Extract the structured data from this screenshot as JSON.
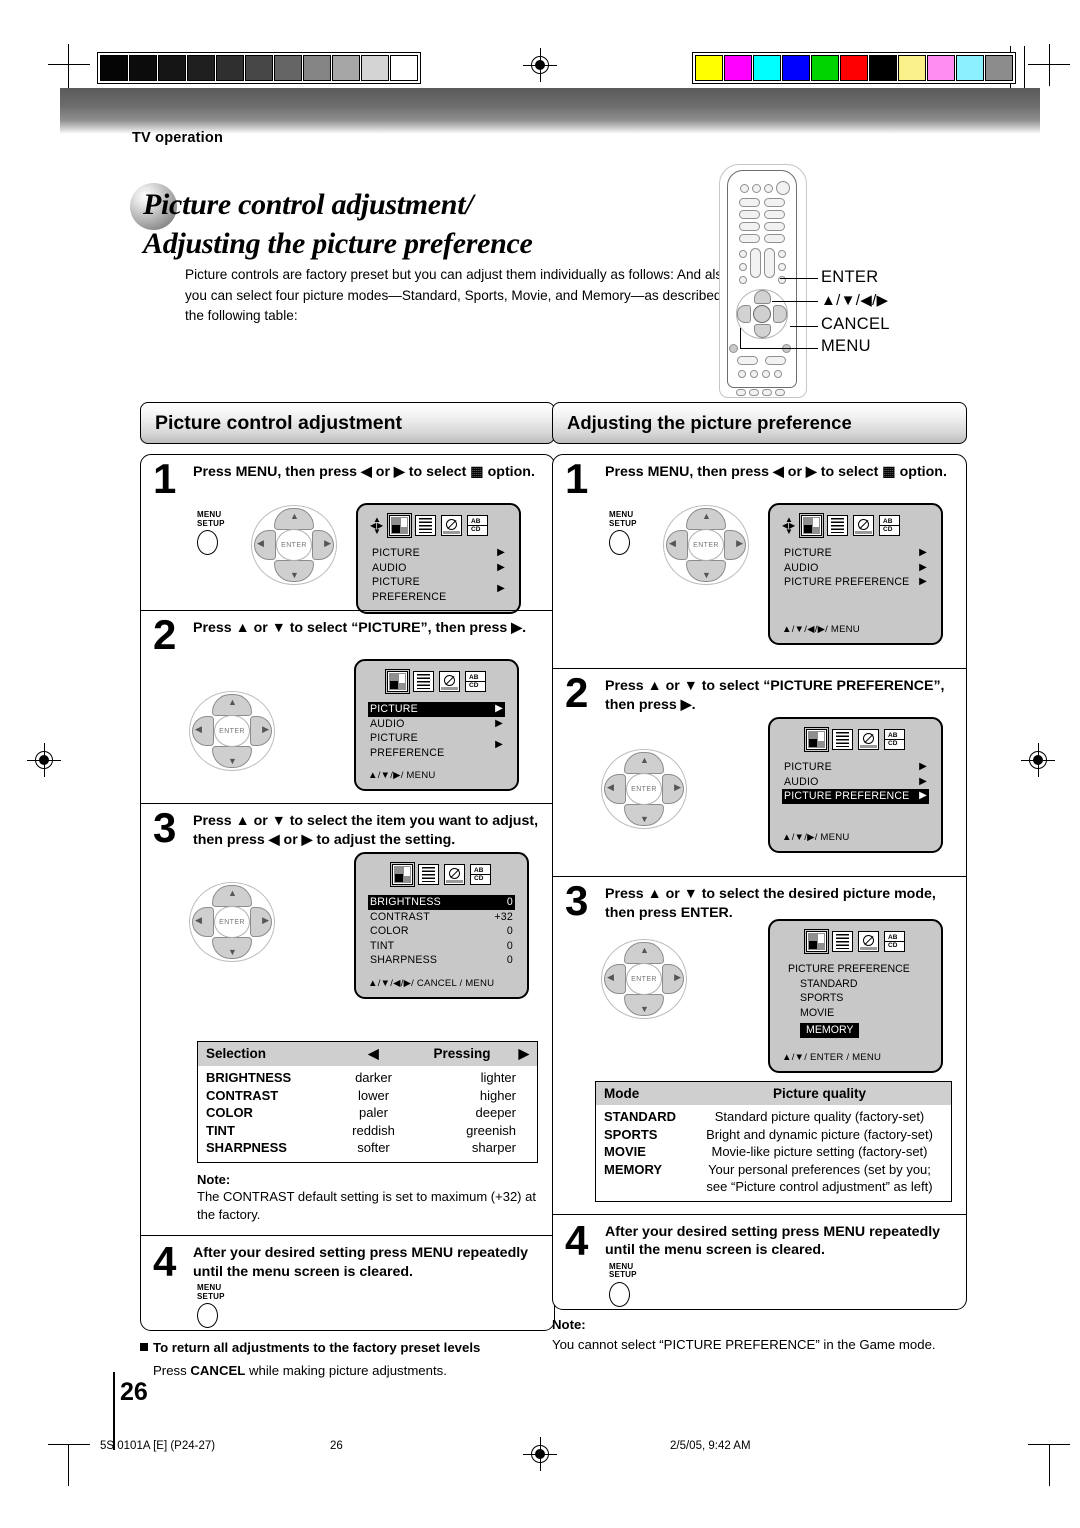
{
  "header": {
    "section_label": "TV operation"
  },
  "title": {
    "line1": "Picture control adjustment/",
    "line2": "Adjusting the picture preference"
  },
  "intro": "Picture controls are factory preset but you can adjust them individually as follows: And also you can select four picture modes—Standard, Sports, Movie, and Memory—as described in the following table:",
  "remote_callouts": [
    {
      "label": "ENTER"
    },
    {
      "label": "▲/▼/◀/▶"
    },
    {
      "label": "CANCEL"
    },
    {
      "label": "MENU"
    }
  ],
  "osd_common": {
    "menu_rows": [
      "PICTURE",
      "AUDIO",
      "PICTURE  PREFERENCE"
    ],
    "arrow": "▶",
    "icon_names": [
      "picture-icon",
      "audio-icon",
      "function-icon",
      "captions-icon"
    ],
    "captions_icon_top": "AB",
    "captions_icon_bottom": "CD"
  },
  "left_column": {
    "title": "Picture control adjustment",
    "steps": [
      {
        "num": "1",
        "text": "Press MENU, then press ◀ or ▶ to select ▦ option.",
        "menu_button": {
          "line1": "MENU",
          "line2": "SETUP"
        },
        "dpad_center": "ENTER",
        "osd": {
          "hint": ""
        }
      },
      {
        "num": "2",
        "text": "Press ▲ or ▼ to select “PICTURE”, then press ▶.",
        "dpad_center": "ENTER",
        "osd": {
          "highlight": "PICTURE",
          "hint": "▲/▼/▶/ MENU"
        }
      },
      {
        "num": "3",
        "text": "Press ▲ or ▼ to select the item you want to adjust, then press ◀ or ▶ to adjust the setting.",
        "dpad_center": "ENTER",
        "osd": {
          "items": [
            {
              "name": "BRIGHTNESS",
              "value": "0",
              "highlight": true
            },
            {
              "name": "CONTRAST",
              "value": "+32",
              "highlight": false
            },
            {
              "name": "COLOR",
              "value": "0",
              "highlight": false
            },
            {
              "name": "TINT",
              "value": "0",
              "highlight": false
            },
            {
              "name": "SHARPNESS",
              "value": "0",
              "highlight": false
            }
          ],
          "hint": "▲/▼/◀/▶/ CANCEL / MENU"
        }
      },
      {
        "num": "4",
        "text": "After your desired setting press MENU repeatedly until the menu screen is cleared.",
        "menu_button": {
          "line1": "MENU",
          "line2": "SETUP"
        }
      }
    ],
    "table": {
      "headers": {
        "selection": "Selection",
        "left_arrow": "◀",
        "pressing": "Pressing",
        "right_arrow": "▶"
      },
      "rows": [
        {
          "selection": "BRIGHTNESS",
          "left": "darker",
          "right": "lighter"
        },
        {
          "selection": "CONTRAST",
          "left": "lower",
          "right": "higher"
        },
        {
          "selection": "COLOR",
          "left": "paler",
          "right": "deeper"
        },
        {
          "selection": "TINT",
          "left": "reddish",
          "right": "greenish"
        },
        {
          "selection": "SHARPNESS",
          "left": "softer",
          "right": "sharper"
        }
      ]
    },
    "note": {
      "label": "Note:",
      "text": "The CONTRAST default setting is set to maximum (+32) at the factory."
    },
    "footnote": {
      "heading": "To return all adjustments to the factory preset levels",
      "body_pre": "Press ",
      "body_bold": "CANCEL",
      "body_post": " while making picture adjustments."
    }
  },
  "right_column": {
    "title": "Adjusting the picture preference",
    "steps": [
      {
        "num": "1",
        "text": "Press MENU, then press ◀ or ▶ to select ▦ option.",
        "menu_button": {
          "line1": "MENU",
          "line2": "SETUP"
        },
        "dpad_center": "ENTER",
        "osd": {
          "hint": "▲/▼/◀/▶/ MENU"
        }
      },
      {
        "num": "2",
        "text": "Press ▲ or ▼ to select “PICTURE PREFERENCE”, then press ▶.",
        "dpad_center": "ENTER",
        "osd": {
          "highlight": "PICTURE  PREFERENCE",
          "hint": "▲/▼/▶/ MENU"
        }
      },
      {
        "num": "3",
        "text": "Press ▲ or ▼ to select the desired picture mode, then press ENTER.",
        "dpad_center": "ENTER",
        "osd": {
          "heading": "PICTURE PREFERENCE",
          "modes": [
            {
              "name": "STANDARD",
              "highlight": false
            },
            {
              "name": "SPORTS",
              "highlight": false
            },
            {
              "name": "MOVIE",
              "highlight": false
            },
            {
              "name": "MEMORY",
              "highlight": true
            }
          ],
          "hint": "▲/▼/ ENTER / MENU"
        }
      },
      {
        "num": "4",
        "text": "After your desired setting press MENU repeatedly until the menu screen is cleared.",
        "menu_button": {
          "line1": "MENU",
          "line2": "SETUP"
        }
      }
    ],
    "table": {
      "headers": {
        "mode": "Mode",
        "quality": "Picture quality"
      },
      "rows": [
        {
          "mode": "STANDARD",
          "quality": "Standard picture quality (factory-set)"
        },
        {
          "mode": "SPORTS",
          "quality": "Bright and dynamic picture (factory-set)"
        },
        {
          "mode": "MOVIE",
          "quality": "Movie-like picture setting (factory-set)"
        },
        {
          "mode": "MEMORY",
          "quality": "Your personal preferences (set by you; see “Picture control adjustment” as left)"
        }
      ]
    },
    "note": {
      "label": "Note:",
      "text": "You cannot select “PICTURE PREFERENCE” in the Game mode."
    }
  },
  "page_number": "26",
  "footer": {
    "left": "5S 0101A [E] (P24-27)",
    "center": "26",
    "right": "2/5/05, 9:42 AM"
  },
  "strips": {
    "gray": [
      "#050505",
      "#0c0c0c",
      "#151515",
      "#1f1f1f",
      "#2f2f2f",
      "#474747",
      "#656565",
      "#848484",
      "#a6a6a6",
      "#d4d4d4",
      "#ffffff"
    ],
    "color": [
      "#ffff00",
      "#ff00ff",
      "#00ffff",
      "#0000ff",
      "#00d400",
      "#ff0000",
      "#000000",
      "#faf08a",
      "#ff8cf0",
      "#8cf0ff",
      "#8c8c8c"
    ]
  }
}
